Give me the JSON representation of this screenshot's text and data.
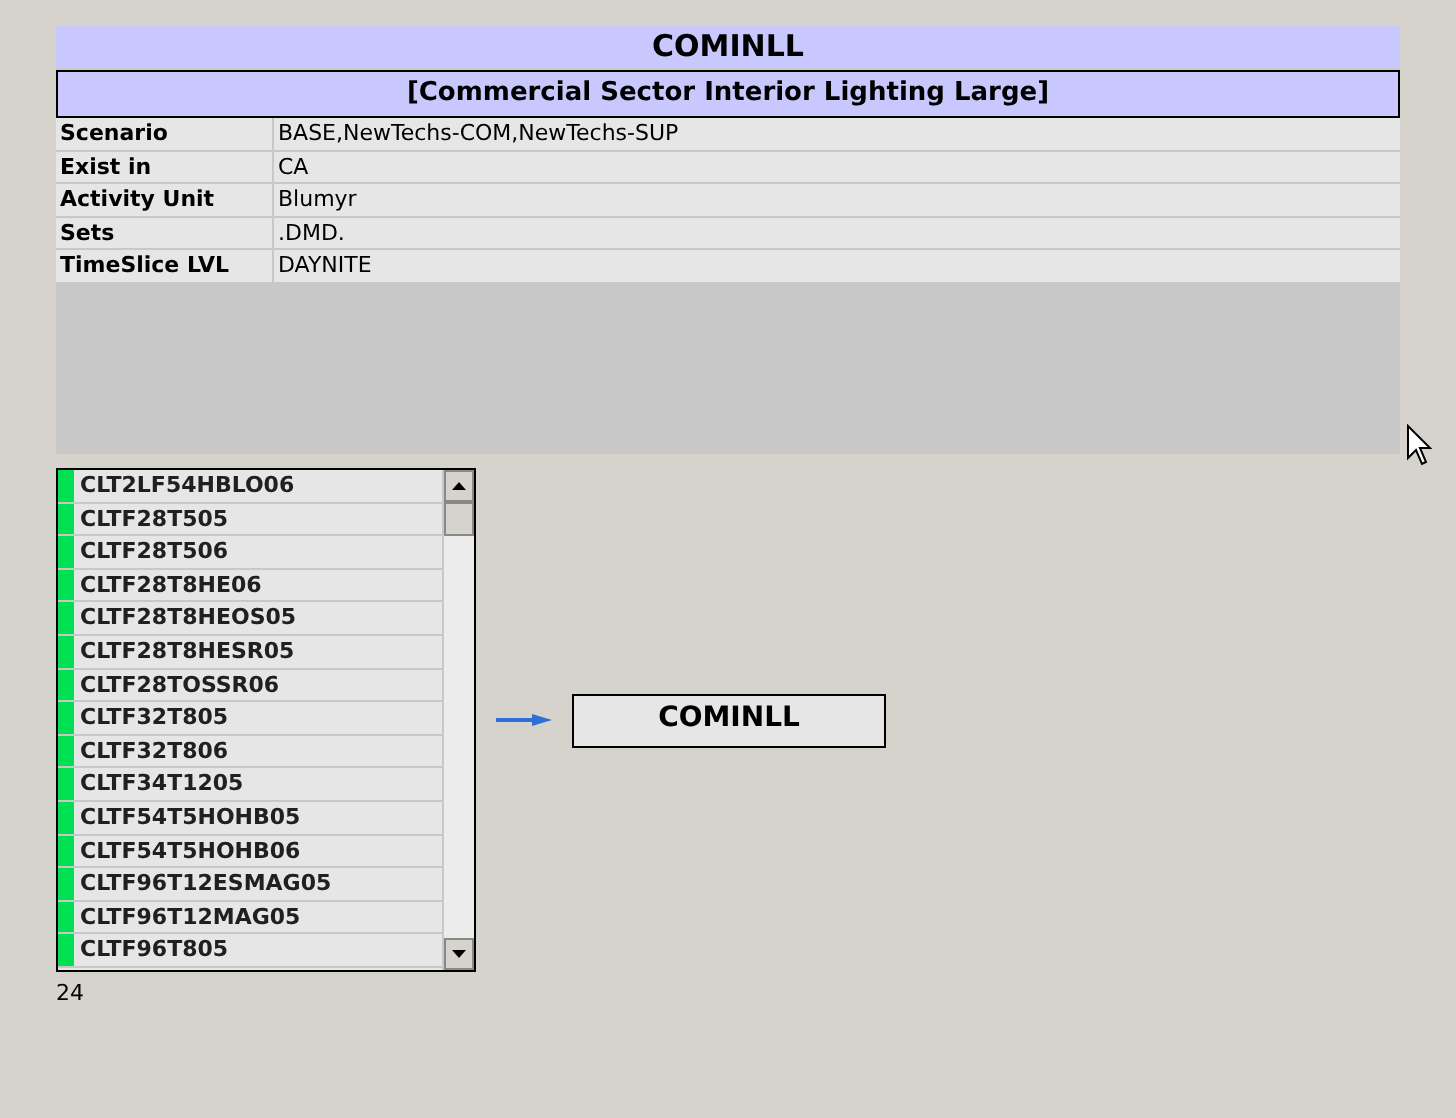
{
  "title": "COMINLL",
  "subtitle": "[Commercial Sector Interior Lighting Large]",
  "properties": [
    {
      "label": "Scenario",
      "value": "BASE,NewTechs-COM,NewTechs-SUP"
    },
    {
      "label": "Exist in",
      "value": "CA"
    },
    {
      "label": "Activity Unit",
      "value": "Blumyr"
    },
    {
      "label": "Sets",
      "value": ".DMD."
    },
    {
      "label": "TimeSlice LVL",
      "value": "DAYNITE"
    }
  ],
  "process_list": {
    "items": [
      {
        "name": "CLT2LF54HBLO06",
        "color": "#00e050"
      },
      {
        "name": "CLTF28T505",
        "color": "#00e050"
      },
      {
        "name": "CLTF28T506",
        "color": "#00e050"
      },
      {
        "name": "CLTF28T8HE06",
        "color": "#00e050"
      },
      {
        "name": "CLTF28T8HEOS05",
        "color": "#00e050"
      },
      {
        "name": "CLTF28T8HESR05",
        "color": "#00e050"
      },
      {
        "name": "CLTF28TOSSR06",
        "color": "#00e050"
      },
      {
        "name": "CLTF32T805",
        "color": "#00e050"
      },
      {
        "name": "CLTF32T806",
        "color": "#00e050"
      },
      {
        "name": "CLTF34T1205",
        "color": "#00e050"
      },
      {
        "name": "CLTF54T5HOHB05",
        "color": "#00e050"
      },
      {
        "name": "CLTF54T5HOHB06",
        "color": "#00e050"
      },
      {
        "name": "CLTF96T12ESMAG05",
        "color": "#00e050"
      },
      {
        "name": "CLTF96T12MAG05",
        "color": "#00e050"
      },
      {
        "name": "CLTF96T805",
        "color": "#00e050"
      }
    ],
    "count": "24"
  },
  "target": {
    "label": "COMINLL"
  }
}
